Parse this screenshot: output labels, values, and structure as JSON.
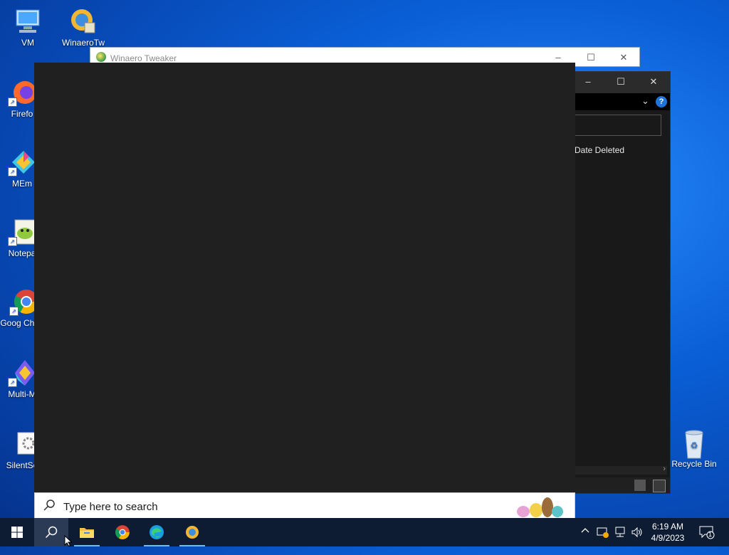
{
  "desktop": {
    "icons": [
      {
        "label": "VM"
      },
      {
        "label": "WinaeroTw"
      },
      {
        "label": "Firefo"
      },
      {
        "label": "MEm"
      },
      {
        "label": "Notepa"
      },
      {
        "label": "Goog Chron"
      },
      {
        "label": "Multi-M"
      },
      {
        "label": "SilentSe"
      },
      {
        "label": "Recycle Bin"
      }
    ]
  },
  "winaero_window": {
    "title": "Winaero Tweaker",
    "minimize": "–",
    "maximize": "☐",
    "close": "✕"
  },
  "recycle_window": {
    "minimize": "–",
    "maximize": "☐",
    "close": "✕",
    "column_header": "Date Deleted",
    "help": "?"
  },
  "search": {
    "placeholder": "Type here to search"
  },
  "taskbar": {
    "apps": [
      {
        "name": "start",
        "icon": "windows-logo-icon"
      },
      {
        "name": "search",
        "icon": "search-icon"
      },
      {
        "name": "file-explorer",
        "icon": "folder-icon"
      },
      {
        "name": "chrome",
        "icon": "chrome-icon"
      },
      {
        "name": "edge",
        "icon": "edge-icon"
      },
      {
        "name": "winaero-tweaker",
        "icon": "winaero-icon"
      }
    ],
    "clock": {
      "time": "6:19 AM",
      "date": "4/9/2023"
    },
    "notifications_count": "1"
  },
  "colors": {
    "accent": "#76b9ed",
    "taskbar": "#0d1b33",
    "flyout": "#202020"
  }
}
